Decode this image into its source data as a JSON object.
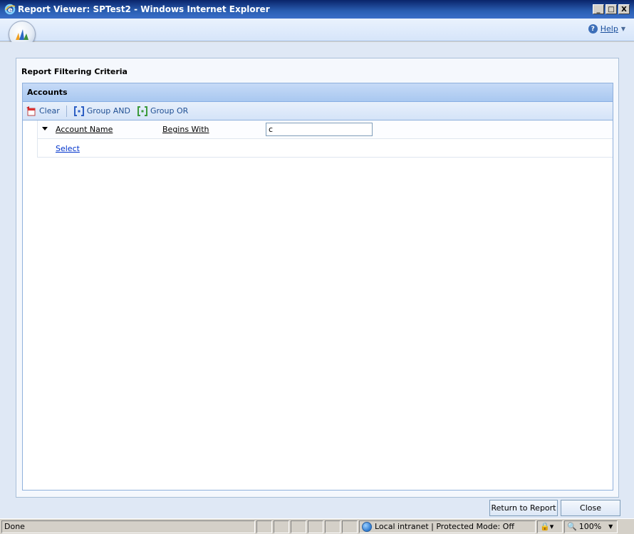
{
  "window": {
    "title": "Report Viewer: SPTest2 - Windows Internet Explorer",
    "min_label": "_",
    "max_label": "□",
    "close_label": "X"
  },
  "header": {
    "help_label": "Help",
    "help_glyph": "?"
  },
  "panel": {
    "title": "Report Filtering Criteria"
  },
  "grid": {
    "entity": "Accounts",
    "toolbar": {
      "clear": "Clear",
      "group_and": "Group AND",
      "group_or": "Group OR"
    },
    "criteria": {
      "field": "Account Name",
      "operator": "Begins With",
      "value": "c"
    },
    "select_link": "Select"
  },
  "buttons": {
    "return": "Return to Report",
    "close": "Close"
  },
  "status": {
    "done": "Done",
    "zone": "Local intranet | Protected Mode: Off",
    "zoom": "100%"
  },
  "colors": {
    "titlebar": "#0a246a",
    "grid_header": "#a9c8f0",
    "link": "#0033cc"
  }
}
